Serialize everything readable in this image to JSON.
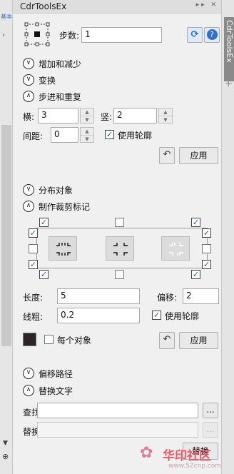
{
  "left_strip": {
    "tab_hint": "基本"
  },
  "title": "CdrToolsEx",
  "right_tab": "CdrToolsEx",
  "steps": {
    "label": "步数:",
    "value": "1"
  },
  "sections": {
    "add_reduce": "增加和减少",
    "transform": "变换",
    "step_repeat": "步进和重复",
    "distribute": "分布对象",
    "crop_marks": "制作裁剪标记",
    "offset_path": "偏移路径",
    "replace_text": "替换文字"
  },
  "step_repeat": {
    "horizontal_label": "横:",
    "horizontal_value": "3",
    "vertical_label": "竖:",
    "vertical_value": "2",
    "spacing_label": "间距:",
    "spacing_value": "0",
    "use_outline_label": "使用轮廓",
    "use_outline_checked": true,
    "apply_label": "应用"
  },
  "crop_marks": {
    "length_label": "长度:",
    "length_value": "5",
    "offset_label": "偏移:",
    "offset_value": "2",
    "line_width_label": "线粗:",
    "line_width_value": "0.2",
    "use_outline_label": "使用轮廓",
    "use_outline_checked": true,
    "per_object_label": "每个对象",
    "per_object_checked": false,
    "apply_label": "应用",
    "swatch_color": "#2b2623"
  },
  "replace_text": {
    "find_label": "查找:",
    "find_value": "",
    "replace_label": "替换:",
    "replace_value": "",
    "browse_label": "...",
    "replace_button_label": "替换"
  },
  "watermark": {
    "text": "华印社区",
    "sub": "www.52cnp.com"
  },
  "colors": {
    "check": "#1a5fb4",
    "refresh_icon_bg": "#3a7bd5",
    "help_icon_bg": "#2f6fd0"
  }
}
